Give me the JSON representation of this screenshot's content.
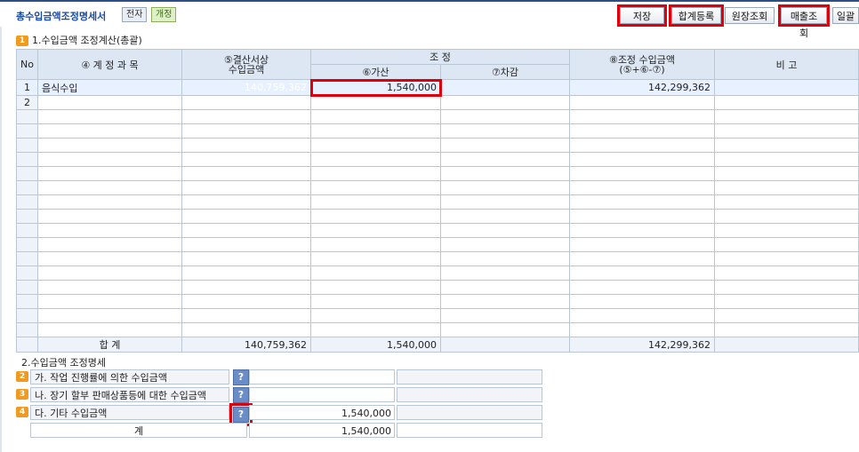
{
  "header": {
    "title": "총수입금액조정명세서",
    "badges": [
      "전자",
      "개정"
    ],
    "buttons": [
      "저장",
      "합계등록",
      "원장조회",
      "매출조회",
      "일괄"
    ]
  },
  "section1": {
    "num": "1",
    "title": "1.수입금액 조정계산(총괄)",
    "columns": {
      "no": "No",
      "item": "④ 계 정 과 목",
      "book_1": "⑤결산서상",
      "book_2": "수입금액",
      "adjust": "조 정",
      "add": "⑥가산",
      "sub": "⑦차감",
      "result_1": "⑧조정 수입금액",
      "result_2": "(⑤+⑥-⑦)",
      "note": "비 고"
    },
    "rows": [
      {
        "no": "1",
        "item": "음식수입",
        "book": "140,759,362",
        "add": "1,540,000",
        "sub": "",
        "result": "142,299,362",
        "note": ""
      },
      {
        "no": "2",
        "item": "",
        "book": "",
        "add": "",
        "sub": "",
        "result": "",
        "note": ""
      }
    ],
    "total": {
      "label": "합 계",
      "book": "140,759,362",
      "add": "1,540,000",
      "sub": "",
      "result": "142,299,362"
    }
  },
  "section2": {
    "title": "2.수입금액 조정명세",
    "items": [
      {
        "num": "2",
        "label": "가. 작업 진행률에 의한 수입금액",
        "value": ""
      },
      {
        "num": "3",
        "label": "나. 장기 할부 판매상품등에 대한 수입금액",
        "value": ""
      },
      {
        "num": "4",
        "label": "다. 기타 수입금액",
        "value": "1,540,000"
      }
    ],
    "total": {
      "label": "계",
      "value": "1,540,000"
    },
    "help": "?"
  }
}
